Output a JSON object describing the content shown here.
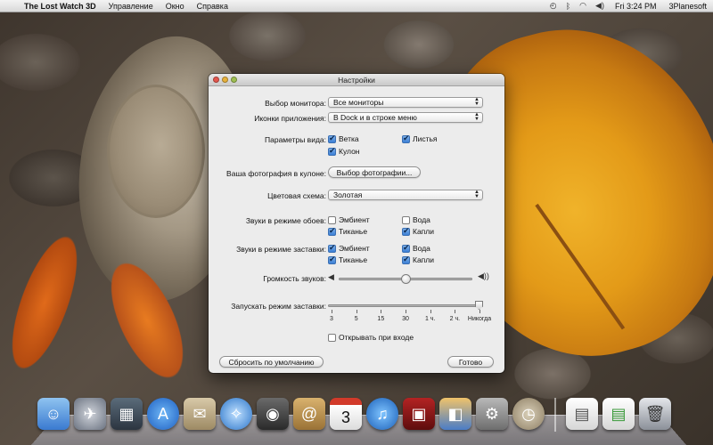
{
  "menubar": {
    "app_name": "The Lost Watch 3D",
    "items": [
      "Управление",
      "Окно",
      "Справка"
    ],
    "clock": "Fri 3:24 PM",
    "user": "3Planesoft",
    "status_icons": [
      "time-machine-icon",
      "bluetooth-icon",
      "wifi-icon",
      "volume-icon"
    ]
  },
  "window": {
    "title": "Настройки",
    "monitor": {
      "label": "Выбор монитора:",
      "value": "Все мониторы"
    },
    "app_icons": {
      "label": "Иконки приложения:",
      "value": "В Dock и в строке меню"
    },
    "view_params": {
      "label": "Параметры вида:",
      "options": [
        {
          "label": "Ветка",
          "checked": true
        },
        {
          "label": "Листья",
          "checked": true
        },
        {
          "label": "Кулон",
          "checked": true
        }
      ]
    },
    "photo": {
      "label": "Ваша фотография в кулоне:",
      "button": "Выбор фотографии..."
    },
    "color_scheme": {
      "label": "Цветовая схема:",
      "value": "Золотая"
    },
    "wallpaper_sounds": {
      "label": "Звуки в режиме обоев:",
      "options": [
        {
          "label": "Эмбиент",
          "checked": false
        },
        {
          "label": "Вода",
          "checked": false
        },
        {
          "label": "Тиканье",
          "checked": true
        },
        {
          "label": "Капли",
          "checked": true
        }
      ]
    },
    "saver_sounds": {
      "label": "Звуки в режиме заставки:",
      "options": [
        {
          "label": "Эмбиент",
          "checked": true
        },
        {
          "label": "Вода",
          "checked": true
        },
        {
          "label": "Тиканье",
          "checked": true
        },
        {
          "label": "Капли",
          "checked": true
        }
      ]
    },
    "volume": {
      "label": "Громкость звуков:",
      "level": 0.5
    },
    "screensaver": {
      "label": "Запускать режим заставки:",
      "ticks": [
        "3",
        "5",
        "15",
        "30",
        "1 ч.",
        "2 ч.",
        "Никогда"
      ],
      "selected": "Никогда"
    },
    "open_at_login": {
      "label": "Открывать при входе",
      "checked": false
    },
    "reset_button": "Сбросить по умолчанию",
    "done_button": "Готово"
  },
  "dock": {
    "apps": [
      "finder-icon",
      "launchpad-icon",
      "mission-control-icon",
      "app-store-icon",
      "mail-icon",
      "safari-icon",
      "facetime-icon",
      "address-book-icon",
      "calendar-icon",
      "itunes-icon",
      "photo-booth-icon",
      "iphoto-icon",
      "system-preferences-icon",
      "lost-watch-icon"
    ],
    "calendar_day": "3",
    "others": [
      "document-icon",
      "document-icon-2",
      "trash-icon"
    ]
  }
}
